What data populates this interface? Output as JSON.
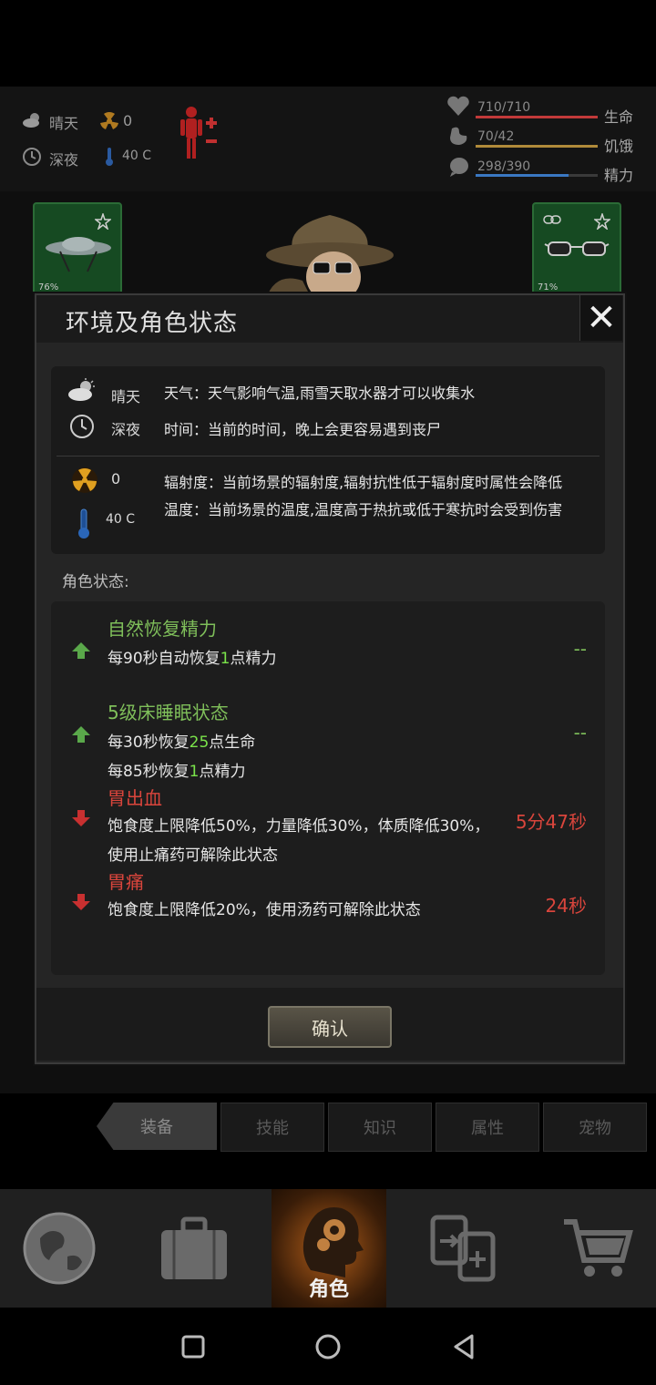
{
  "top_status": {
    "weather": "晴天",
    "radiation": "0",
    "time_of_day": "深夜",
    "temperature": "40 C",
    "hp_value": "710/710",
    "hp_label": "生命",
    "hunger_value": "70/42",
    "hunger_label": "饥饿",
    "energy_value": "298/390",
    "energy_label": "精力",
    "hp_fraction": 1.0,
    "hunger_fraction": 1.0,
    "energy_fraction": 0.76
  },
  "equipment": {
    "left_slot_pct": "76%",
    "right_slot_pct": "71%"
  },
  "dialog": {
    "title": "环境及角色状态",
    "close_icon": "close-icon",
    "env": {
      "weather_label": "晴天",
      "weather_desc": "天气：天气影响气温,雨雪天取水器才可以收集水",
      "time_label": "深夜",
      "time_desc": "时间：当前的时间，晚上会更容易遇到丧尸",
      "radiation_label": "0",
      "radiation_desc": "辐射度：当前场景的辐射度,辐射抗性低于辐射度时属性会降低",
      "temperature_label": "40 C",
      "temperature_desc": "温度：当前场景的温度,温度高于热抗或低于寒抗时会受到伤害"
    },
    "role_status_label": "角色状态:",
    "statuses": [
      {
        "title": "自然恢复精力",
        "line1_pre": "每90秒自动恢复",
        "line1_num": "1",
        "line1_post": "点精力",
        "time": "--"
      },
      {
        "title": "5级床睡眠状态",
        "line1_pre": "每30秒恢复",
        "line1_num": "25",
        "line1_post": "点生命",
        "line2_pre": "每85秒恢复",
        "line2_num": "1",
        "line2_post": "点精力",
        "time": "--"
      },
      {
        "title": "胃出血",
        "line1": "饱食度上限降低50%，力量降低30%，体质降低30%，",
        "line2": "使用止痛药可解除此状态",
        "time": "5分47秒"
      },
      {
        "title": "胃痛",
        "line1": "饱食度上限降低20%，使用汤药可解除此状态",
        "time": "24秒"
      }
    ],
    "confirm_label": "确认"
  },
  "tabs": [
    "装备",
    "技能",
    "知识",
    "属性",
    "宠物"
  ],
  "bottom_nav": {
    "role_label": "角色"
  },
  "colors": {
    "good": "#7fbf5a",
    "bad": "#d9453c",
    "hp_bar": "#c23a3a",
    "hunger_bar": "#b08a3a",
    "energy_bar": "#3a78c2"
  }
}
